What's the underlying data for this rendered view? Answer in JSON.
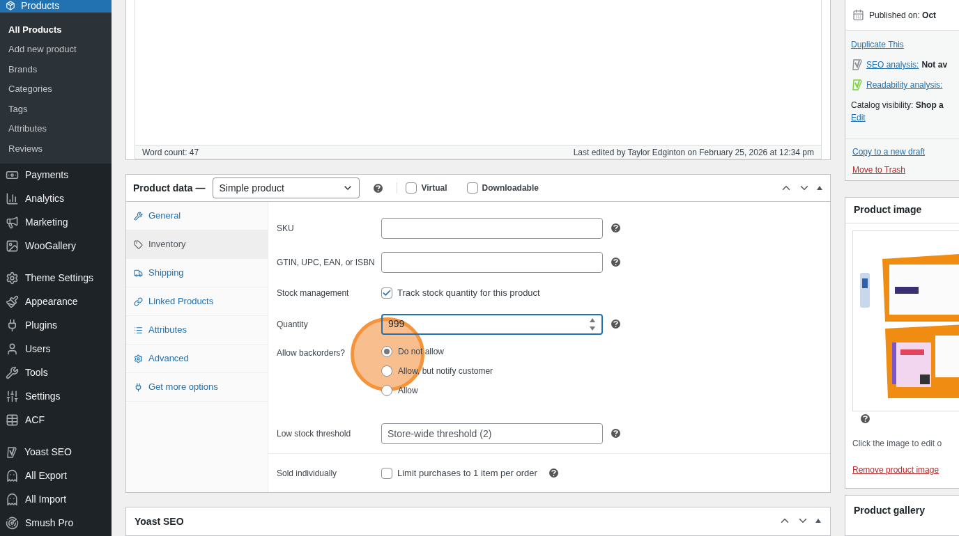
{
  "sidebar": {
    "current": {
      "label": "Products",
      "selected": true
    },
    "submenu": [
      {
        "label": "All Products",
        "selected": true
      },
      {
        "label": "Add new product",
        "selected": false
      },
      {
        "label": "Brands",
        "selected": false
      },
      {
        "label": "Categories",
        "selected": false
      },
      {
        "label": "Tags",
        "selected": false
      },
      {
        "label": "Attributes",
        "selected": false
      },
      {
        "label": "Reviews",
        "selected": false
      }
    ],
    "groups": [
      [
        {
          "label": "Payments"
        },
        {
          "label": "Analytics"
        },
        {
          "label": "Marketing"
        },
        {
          "label": "WooGallery"
        }
      ],
      [
        {
          "label": "Theme Settings"
        },
        {
          "label": "Appearance"
        },
        {
          "label": "Plugins"
        },
        {
          "label": "Users"
        },
        {
          "label": "Tools"
        },
        {
          "label": "Settings"
        },
        {
          "label": "ACF"
        }
      ],
      [
        {
          "label": "Yoast SEO"
        },
        {
          "label": "All Export"
        },
        {
          "label": "All Import"
        },
        {
          "label": "Smush Pro"
        }
      ]
    ]
  },
  "editor": {
    "word_count": "Word count: 47",
    "last_edited": "Last edited by Taylor Edginton on February 25, 2026 at 12:34 pm"
  },
  "product_data": {
    "title": "Product data —",
    "type_select": "Simple product",
    "options": [
      {
        "label": "Virtual",
        "checked": false
      },
      {
        "label": "Downloadable",
        "checked": false
      }
    ],
    "tabs": [
      {
        "label": "General",
        "selected": false
      },
      {
        "label": "Inventory",
        "selected": true
      },
      {
        "label": "Shipping",
        "selected": false
      },
      {
        "label": "Linked Products",
        "selected": false
      },
      {
        "label": "Attributes",
        "selected": false
      },
      {
        "label": "Advanced",
        "selected": false
      },
      {
        "label": "Get more options",
        "selected": false
      }
    ],
    "fields": [
      {
        "kind": "text",
        "label": "SKU",
        "help": true
      },
      {
        "kind": "text",
        "label": "GTIN, UPC, EAN, or ISBN",
        "help": true
      },
      {
        "kind": "checkbox",
        "label": "Stock management",
        "text": "Track stock quantity for this product",
        "checked": true,
        "help": false
      },
      {
        "kind": "number",
        "label": "Quantity",
        "value": "999",
        "focused": true,
        "help": true
      },
      {
        "kind": "radio",
        "label": "Allow backorders?",
        "help": false,
        "choices": [
          {
            "label": "Do not allow",
            "selected": true
          },
          {
            "label": "Allow, but notify customer",
            "selected": false
          },
          {
            "label": "Allow",
            "selected": false
          }
        ]
      },
      {
        "kind": "text",
        "label": "Low stock threshold",
        "placeholder": "Store-wide threshold (2)",
        "help": true
      },
      {
        "kind": "checkbox",
        "label": "Sold individually",
        "text": "Limit purchases to 1 item per order",
        "checked": false,
        "help": true,
        "separated": true
      }
    ]
  },
  "yoast_box": {
    "title": "Yoast SEO"
  },
  "publish": {
    "published_label": "Published on:",
    "published_value": "Oct",
    "duplicate": "Duplicate This",
    "analyses": [
      {
        "link": "SEO analysis:",
        "value": "Not av",
        "color": "#8c8f94"
      },
      {
        "link": "Readability analysis:",
        "color": "#7ad03a"
      }
    ],
    "catalog_label": "Catalog visibility:",
    "catalog_value": "Shop a",
    "catalog_edit": "Edit",
    "actions": [
      {
        "label": "Copy to a new draft",
        "kind": "link"
      },
      {
        "label": "Move to Trash",
        "kind": "danger"
      }
    ]
  },
  "product_image": {
    "title": "Product image",
    "hint": "Click the image to edit o",
    "remove": "Remove product image"
  },
  "product_gallery": {
    "title": "Product gallery"
  }
}
